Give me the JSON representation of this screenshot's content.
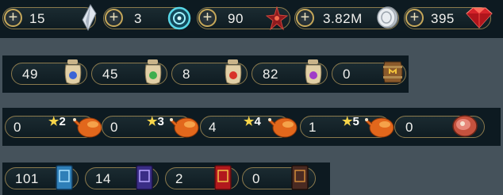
{
  "currencies": [
    {
      "value": "15",
      "icon": "crystal-shard-icon"
    },
    {
      "value": "3",
      "icon": "mystery-orb-icon"
    },
    {
      "value": "90",
      "icon": "red-star-shard-icon"
    },
    {
      "value": "3.82M",
      "icon": "silver-coin-icon"
    },
    {
      "value": "395",
      "icon": "ruby-gem-icon"
    }
  ],
  "potions": [
    {
      "value": "49",
      "icon": "blue-potion-jar-icon"
    },
    {
      "value": "45",
      "icon": "green-potion-jar-icon"
    },
    {
      "value": "8",
      "icon": "red-potion-jar-icon"
    },
    {
      "value": "82",
      "icon": "purple-potion-jar-icon"
    },
    {
      "value": "0",
      "icon": "barrel-icon"
    }
  ],
  "food": [
    {
      "value": "0",
      "stars": "2",
      "icon": "roast-chicken-icon"
    },
    {
      "value": "0",
      "stars": "3",
      "icon": "roast-chicken-icon"
    },
    {
      "value": "4",
      "stars": "4",
      "icon": "roast-chicken-icon"
    },
    {
      "value": "1",
      "stars": "5",
      "icon": "roast-chicken-icon"
    },
    {
      "value": "0",
      "stars": "",
      "icon": "ham-icon"
    }
  ],
  "books": [
    {
      "value": "101",
      "icon": "blue-tome-icon"
    },
    {
      "value": "14",
      "icon": "purple-tome-icon"
    },
    {
      "value": "2",
      "icon": "red-tome-icon"
    },
    {
      "value": "0",
      "icon": "dark-tome-icon"
    }
  ],
  "plus_symbol": "+",
  "star_symbol": "★"
}
